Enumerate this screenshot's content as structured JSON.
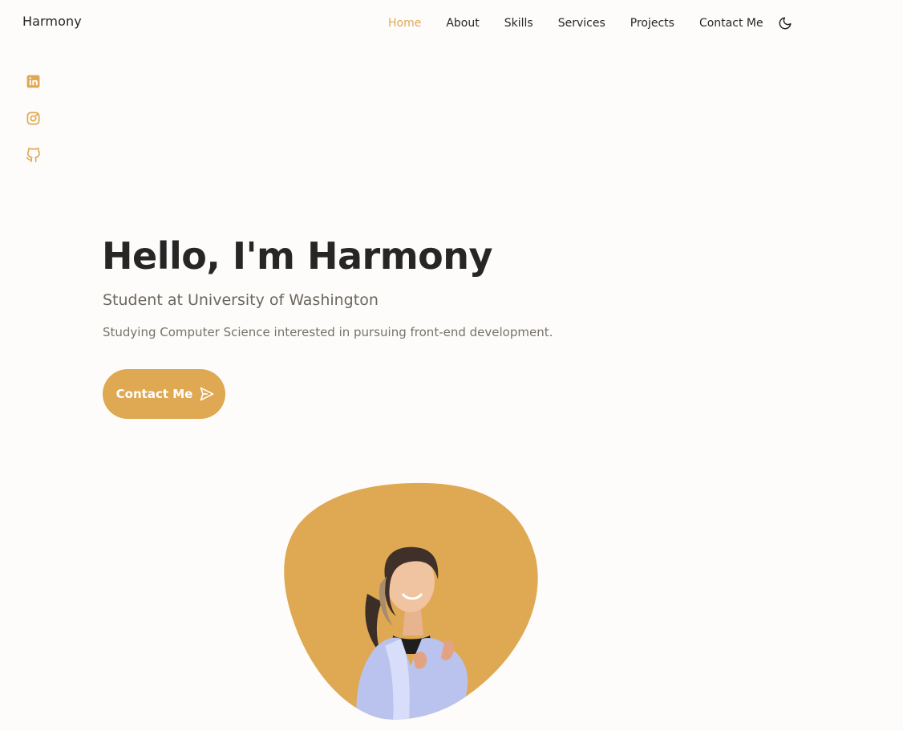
{
  "header": {
    "brand": "Harmony",
    "nav": [
      "Home",
      "About",
      "Skills",
      "Services",
      "Projects",
      "Contact Me"
    ],
    "active_item": "Home",
    "theme_toggle_icon": "moon-icon"
  },
  "socials": {
    "icons": [
      "linkedin-icon",
      "instagram-icon",
      "github-icon"
    ]
  },
  "hero": {
    "title": "Hello, I'm Harmony",
    "subtitle": "Student at University of Washington",
    "description": "Studying Computer Science interested in pursuing front-end development.",
    "button_label": "Contact Me",
    "button_icon": "send-icon"
  },
  "colors": {
    "accent": "#dfa853",
    "background": "#fefcfa",
    "text": "#262626",
    "subtitle": "#6b6760"
  }
}
